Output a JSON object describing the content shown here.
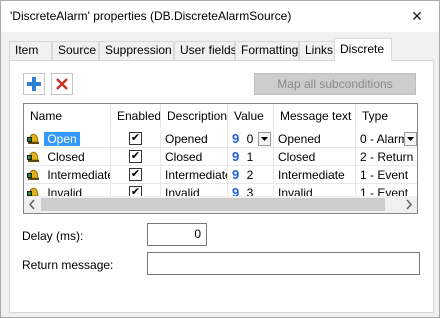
{
  "window": {
    "title": "'DiscreteAlarm' properties (DB.DiscreteAlarmSource)",
    "close_glyph": "✕"
  },
  "tabs": [
    "Item",
    "Source",
    "Suppression",
    "User fields",
    "Formatting",
    "Links",
    "Discrete"
  ],
  "active_tab": "Discrete",
  "toolbar": {
    "add_icon": "plus-icon",
    "delete_icon": "delete-x-icon",
    "map_label": "Map all subconditions"
  },
  "grid": {
    "columns": [
      "Name",
      "Enabled",
      "Description",
      "Value",
      "Message text",
      "Type"
    ],
    "rows": [
      {
        "name": "Open",
        "enabled": "✔",
        "description": "Opened",
        "value": "0",
        "message": "Opened",
        "type": "0 - Alarm",
        "selected": true
      },
      {
        "name": "Closed",
        "enabled": "✔",
        "description": "Closed",
        "value": "1",
        "message": "Closed",
        "type": "2 - Return",
        "selected": false
      },
      {
        "name": "Intermediate",
        "enabled": "✔",
        "description": "Intermediate",
        "value": "2",
        "message": "Intermediate",
        "type": "1 - Event",
        "selected": false
      },
      {
        "name": "Invalid",
        "enabled": "✔",
        "description": "Invalid",
        "value": "3",
        "message": "Invalid",
        "type": "1 - Event",
        "selected": false
      }
    ],
    "value_glyph": "9",
    "icons": {
      "row": "alarm-bell-icon",
      "dropdown": "chevron-down-icon"
    }
  },
  "delay": {
    "label": "Delay (ms):",
    "value": "0"
  },
  "return_message": {
    "label": "Return message:",
    "value": ""
  },
  "colors": {
    "selection": "#3399ff",
    "accent_blue": "#1f5fd6",
    "delete_red": "#c0392b"
  }
}
